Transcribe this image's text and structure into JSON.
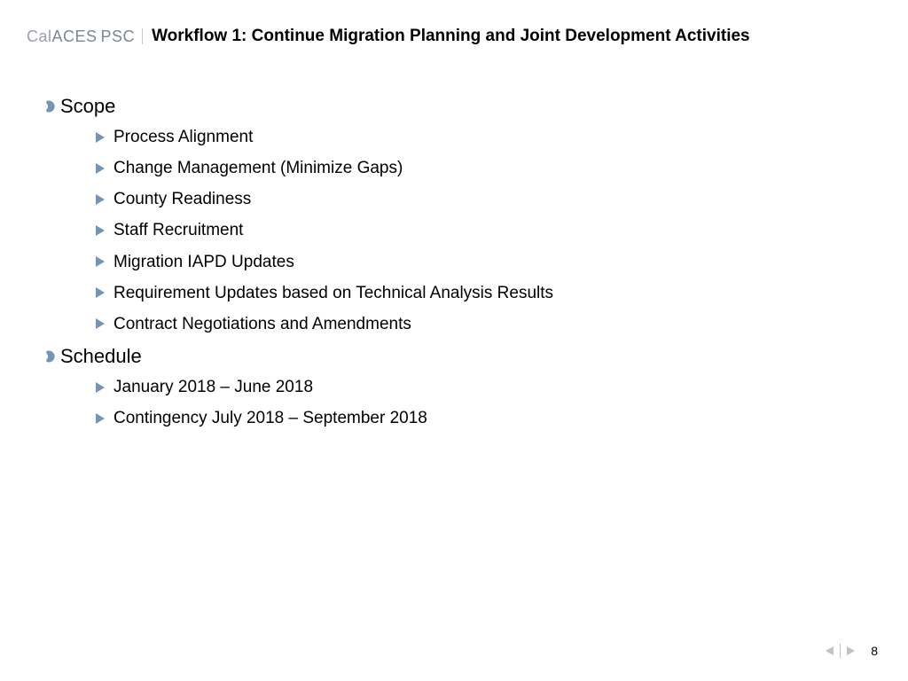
{
  "logo": {
    "part1": "Cal",
    "part2": "ACES",
    "part3": "PSC"
  },
  "title": "Workflow 1: Continue Migration Planning and Joint Development Activities",
  "sections": [
    {
      "heading": "Scope",
      "items": [
        "Process Alignment",
        "Change Management (Minimize Gaps)",
        "County Readiness",
        "Staff Recruitment",
        "Migration IAPD Updates",
        "Requirement Updates based on Technical Analysis Results",
        "Contract Negotiations and Amendments"
      ]
    },
    {
      "heading": "Schedule",
      "items": [
        "January 2018 – June 2018",
        "Contingency July 2018 – September 2018"
      ]
    }
  ],
  "page_number": "8",
  "colors": {
    "accent": "#7394b7",
    "logo_gray": "#9aa0a6"
  }
}
